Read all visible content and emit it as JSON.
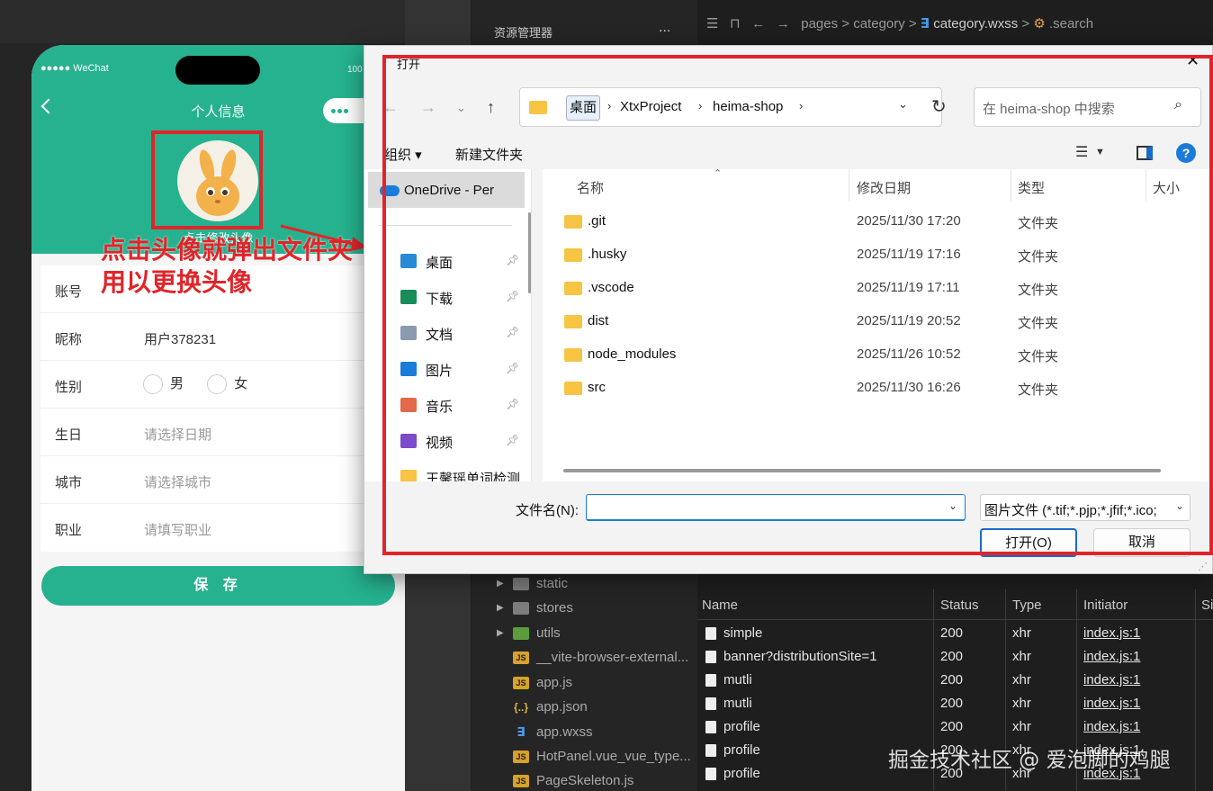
{
  "ide": {
    "explorer_title": "资源管理器",
    "explorer_more": "...",
    "breadcrumb": {
      "parts": [
        "pages",
        "category"
      ],
      "file": "category.wxss",
      "symbol": ".search"
    },
    "tree": [
      {
        "label": "static",
        "kind": "folder",
        "expandable": true
      },
      {
        "label": "stores",
        "kind": "folder",
        "expandable": true
      },
      {
        "label": "utils",
        "kind": "folder",
        "expandable": true
      },
      {
        "label": "__vite-browser-external...",
        "kind": "js"
      },
      {
        "label": "app.js",
        "kind": "js"
      },
      {
        "label": "app.json",
        "kind": "json"
      },
      {
        "label": "app.wxss",
        "kind": "css"
      },
      {
        "label": "HotPanel.vue_vue_type...",
        "kind": "js"
      },
      {
        "label": "PageSkeleton.js",
        "kind": "js"
      }
    ],
    "network": {
      "headers": [
        "Name",
        "Status",
        "Type",
        "Initiator",
        "Si"
      ],
      "rows": [
        {
          "name": "simple",
          "status": "200",
          "type": "xhr",
          "initiator": "index.js:1"
        },
        {
          "name": "banner?distributionSite=1",
          "status": "200",
          "type": "xhr",
          "initiator": "index.js:1"
        },
        {
          "name": "mutli",
          "status": "200",
          "type": "xhr",
          "initiator": "index.js:1"
        },
        {
          "name": "mutli",
          "status": "200",
          "type": "xhr",
          "initiator": "index.js:1"
        },
        {
          "name": "profile",
          "status": "200",
          "type": "xhr",
          "initiator": "index.js:1"
        },
        {
          "name": "profile",
          "status": "200",
          "type": "xhr",
          "initiator": "index.js:1"
        },
        {
          "name": "profile",
          "status": "200",
          "type": "xhr",
          "initiator": "index.js:1"
        }
      ]
    },
    "watermark": "掘金技术社区 @ 爱泡脚的鸡腿"
  },
  "phone": {
    "status_left": "●●●●● WeChat",
    "status_right": "100",
    "nav_title": "个人信息",
    "avatar_tip": "点击修改头像",
    "form": [
      {
        "label": "账号",
        "value": "",
        "placeholder": false
      },
      {
        "label": "昵称",
        "value": "用户378231",
        "placeholder": false
      },
      {
        "label": "性别",
        "options": [
          "男",
          "女"
        ]
      },
      {
        "label": "生日",
        "value": "请选择日期",
        "placeholder": true
      },
      {
        "label": "城市",
        "value": "请选择城市",
        "placeholder": true
      },
      {
        "label": "职业",
        "value": "请填写职业",
        "placeholder": true
      }
    ],
    "save_label": "保 存",
    "annotation": [
      "点击头像就弹出文件夹",
      "用以更换头像"
    ]
  },
  "dialog": {
    "title": "打开",
    "address": [
      "桌面",
      "XtxProject",
      "heima-shop"
    ],
    "search_placeholder": "在 heima-shop 中搜索",
    "toolbar": {
      "organize": "组织 ▾",
      "new_folder": "新建文件夹"
    },
    "sidebar": {
      "onedrive": "OneDrive - Per",
      "items": [
        {
          "label": "桌面",
          "icon": "desktop-icon",
          "color": "#2a8bd5"
        },
        {
          "label": "下载",
          "icon": "download-icon",
          "color": "#1a8c5a"
        },
        {
          "label": "文档",
          "icon": "document-icon",
          "color": "#8a9bb0"
        },
        {
          "label": "图片",
          "icon": "pictures-icon",
          "color": "#1a7cd9"
        },
        {
          "label": "音乐",
          "icon": "music-icon",
          "color": "#e06a4a"
        },
        {
          "label": "视频",
          "icon": "video-icon",
          "color": "#7b4bc9"
        },
        {
          "label": "王馨瑶单词检测",
          "icon": "folder-icon",
          "color": "#f7c443"
        }
      ]
    },
    "columns": [
      "名称",
      "修改日期",
      "类型",
      "大小"
    ],
    "files": [
      {
        "name": ".git",
        "date": "2025/11/30 17:20",
        "type": "文件夹"
      },
      {
        "name": ".husky",
        "date": "2025/11/19 17:16",
        "type": "文件夹"
      },
      {
        "name": ".vscode",
        "date": "2025/11/19 17:11",
        "type": "文件夹"
      },
      {
        "name": "dist",
        "date": "2025/11/19 20:52",
        "type": "文件夹"
      },
      {
        "name": "node_modules",
        "date": "2025/11/26 10:52",
        "type": "文件夹"
      },
      {
        "name": "src",
        "date": "2025/11/30 16:26",
        "type": "文件夹"
      }
    ],
    "filename_label": "文件名(N):",
    "filename_value": "",
    "filetype": "图片文件 (*.tif;*.pjp;*.jfif;*.ico;",
    "open_button": "打开(O)",
    "cancel_button": "取消"
  },
  "colors": {
    "accent": "#26b28f",
    "annotation": "#e0252a",
    "windows_blue": "#1a6bc9"
  }
}
